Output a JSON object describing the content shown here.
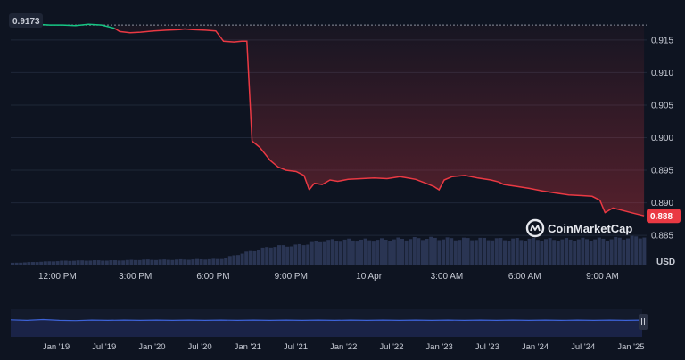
{
  "chart_data": {
    "type": "line",
    "title": "",
    "currency_label": "USD",
    "watermark": "CoinMarketCap",
    "colors": {
      "background": "#0e1421",
      "line_up": "#16c784",
      "line_down": "#ea3943",
      "volume": "#2a3553",
      "navigator_line": "#3d63d8",
      "navigator_fill": "#1a2347",
      "text": "#c8ccd6"
    },
    "ylim": [
      0.8805,
      0.9195
    ],
    "y_ticks": [
      {
        "value": 0.915,
        "label": "0.915"
      },
      {
        "value": 0.91,
        "label": "0.910"
      },
      {
        "value": 0.905,
        "label": "0.905"
      },
      {
        "value": 0.9,
        "label": "0.900"
      },
      {
        "value": 0.895,
        "label": "0.895"
      },
      {
        "value": 0.89,
        "label": "0.890"
      },
      {
        "value": 0.885,
        "label": "0.885"
      }
    ],
    "x_range_hours": [
      0,
      24.5
    ],
    "x_ticks": [
      {
        "value": 1.8,
        "label": "12:00 PM"
      },
      {
        "value": 4.8,
        "label": "3:00 PM"
      },
      {
        "value": 7.8,
        "label": "6:00 PM"
      },
      {
        "value": 10.8,
        "label": "9:00 PM"
      },
      {
        "value": 13.8,
        "label": "10 Apr"
      },
      {
        "value": 16.8,
        "label": "3:00 AM"
      },
      {
        "value": 19.8,
        "label": "6:00 AM"
      },
      {
        "value": 22.8,
        "label": "9:00 AM"
      }
    ],
    "open_price": {
      "value": 0.9173,
      "label": "0.9173"
    },
    "last_price": {
      "value": 0.888,
      "label": "0.888"
    },
    "series": [
      {
        "x": [
          0,
          0.5,
          1.0,
          1.5,
          2.0,
          2.5,
          3.0,
          3.5,
          4.0,
          4.2,
          4.6,
          5.0,
          5.5,
          6.0,
          6.5,
          6.7,
          7.0,
          7.5,
          7.9,
          8.2,
          8.6,
          8.9,
          9.1,
          9.3,
          9.6,
          10.0,
          10.3,
          10.6,
          11.0,
          11.3,
          11.5,
          11.7,
          12.0,
          12.3,
          12.6,
          13.0,
          13.5,
          14.0,
          14.5,
          15.0,
          15.3,
          15.6,
          16.0,
          16.3,
          16.5,
          16.7,
          17.0,
          17.5,
          18.0,
          18.5,
          18.8,
          19.0,
          19.5,
          20.0,
          20.5,
          21.0,
          21.5,
          22.0,
          22.4,
          22.7,
          22.9,
          23.2,
          23.6,
          24.0,
          24.4
        ],
        "values": [
          0.9175,
          0.9172,
          0.9174,
          0.9173,
          0.9173,
          0.9172,
          0.9174,
          0.9173,
          0.9168,
          0.9163,
          0.9161,
          0.9162,
          0.9164,
          0.9165,
          0.9166,
          0.9167,
          0.9166,
          0.9165,
          0.9164,
          0.9148,
          0.9147,
          0.9148,
          0.9148,
          0.8995,
          0.8985,
          0.8965,
          0.8955,
          0.895,
          0.8948,
          0.8942,
          0.892,
          0.893,
          0.8928,
          0.8935,
          0.8933,
          0.8936,
          0.8937,
          0.8938,
          0.8937,
          0.894,
          0.8938,
          0.8936,
          0.893,
          0.8925,
          0.892,
          0.8935,
          0.894,
          0.8942,
          0.8938,
          0.8935,
          0.8932,
          0.8928,
          0.8925,
          0.8922,
          0.8918,
          0.8915,
          0.8912,
          0.8911,
          0.891,
          0.8904,
          0.8885,
          0.8892,
          0.8888,
          0.8884,
          0.888
        ]
      }
    ],
    "volume_ylim": [
      0,
      1
    ],
    "volume": {
      "x": [
        0,
        1,
        2,
        3,
        4,
        5,
        6,
        7,
        8,
        9,
        10,
        11,
        12,
        13,
        14,
        15,
        16,
        17,
        18,
        19,
        20,
        21,
        22,
        23,
        24.4
      ],
      "values": [
        0.05,
        0.08,
        0.11,
        0.12,
        0.12,
        0.14,
        0.14,
        0.15,
        0.16,
        0.35,
        0.52,
        0.55,
        0.68,
        0.7,
        0.7,
        0.73,
        0.75,
        0.73,
        0.73,
        0.72,
        0.72,
        0.71,
        0.72,
        0.73,
        0.8
      ]
    },
    "navigator": {
      "x_ticks": [
        "Jan '19",
        "Jul '19",
        "Jan '20",
        "Jul '20",
        "Jan '21",
        "Jul '21",
        "Jan '22",
        "Jul '22",
        "Jan '23",
        "Jul '23",
        "Jan '24",
        "Jul '24",
        "Jan '25"
      ],
      "values": [
        0.62,
        0.6,
        0.63,
        0.6,
        0.59,
        0.61,
        0.6,
        0.61,
        0.6,
        0.61,
        0.6,
        0.61,
        0.6,
        0.61,
        0.6,
        0.61,
        0.6,
        0.61,
        0.6,
        0.61,
        0.6,
        0.61,
        0.6,
        0.61,
        0.6,
        0.61,
        0.6,
        0.61,
        0.6,
        0.61,
        0.6,
        0.61,
        0.6,
        0.61,
        0.6,
        0.61,
        0.6,
        0.61,
        0.6,
        0.61
      ]
    }
  }
}
